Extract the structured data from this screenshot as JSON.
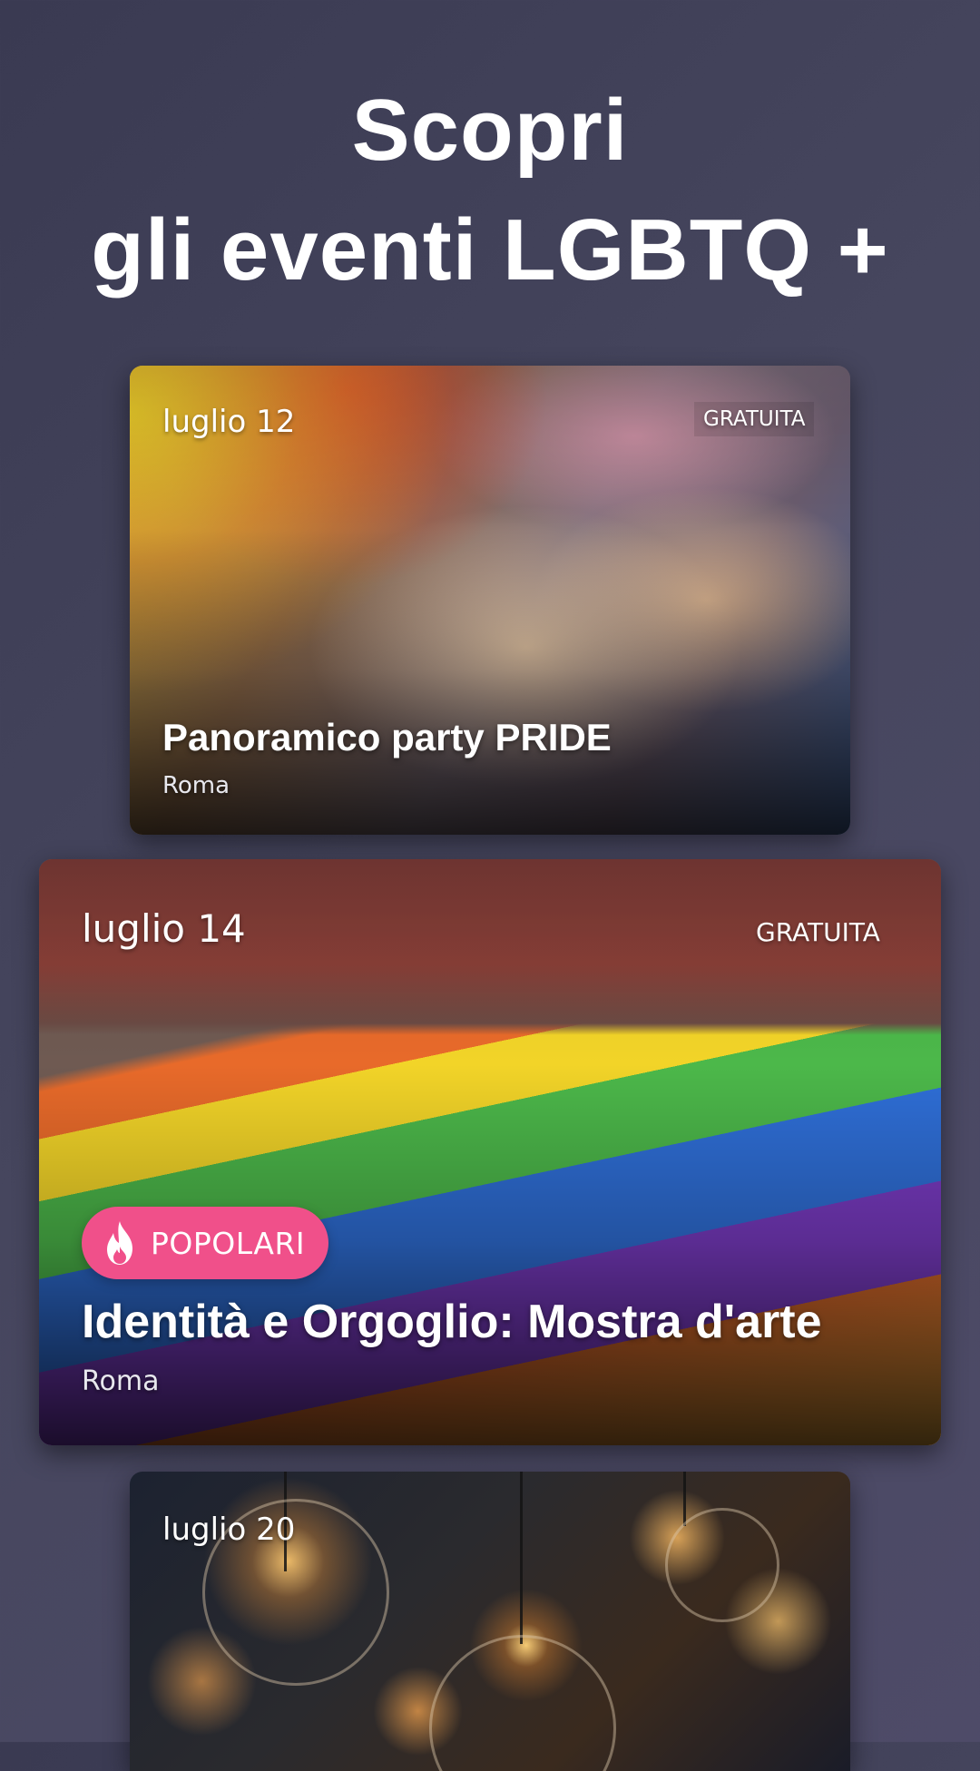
{
  "header": {
    "line1": "Scopri",
    "line2": "gli eventi LGBTQ +"
  },
  "events": [
    {
      "date": "luglio 12",
      "price": "GRATUITA",
      "title": "Panoramico party PRIDE",
      "city": "Roma"
    },
    {
      "date": "luglio 14",
      "price": "GRATUITA",
      "badge": "POPOLARI",
      "badge_icon": "flame-icon",
      "title": "Identità e Orgoglio: Mostra d'arte",
      "city": "Roma"
    },
    {
      "date": "luglio 20"
    }
  ],
  "colors": {
    "background": "#403f57",
    "badge": "#f0508a",
    "text": "#ffffff"
  }
}
